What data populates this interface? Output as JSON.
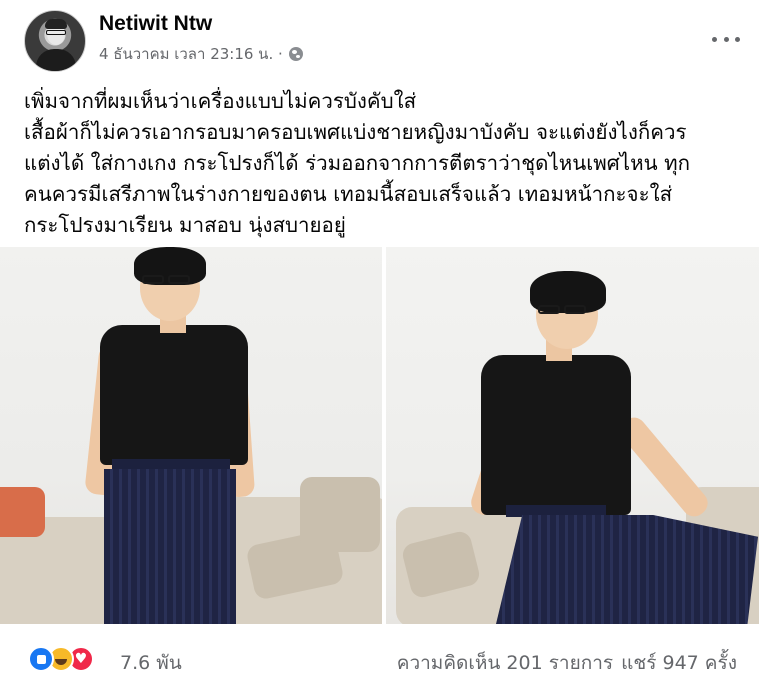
{
  "post": {
    "author": "Netiwit Ntw",
    "timestamp": "4 ธันวาคม เวลา 23:16 น. ·",
    "privacy_icon": "globe-icon",
    "text_lines": [
      "เพิ่มจากที่ผมเห็นว่าเครื่องแบบไม่ควรบังคับใส่",
      "เสื้อผ้าก็ไม่ควรเอากรอบมาครอบเพศแบ่งชายหญิงมาบังคับ จะแต่งยังไงก็ควร",
      "แต่งได้ ใส่กางเกง กระโปรงก็ได้ ร่วมออกจากการตีตราว่าชุดไหนเพศไหน ทุก",
      "คนควรมีเสรีภาพในร่างกายของตน เทอมนี้สอบเสร็จแล้ว เทอมหน้ากะจะใส่",
      "กระโปรงมาเรียน มาสอบ นุ่งสบายอยู่"
    ]
  },
  "footer": {
    "reaction_icons": [
      "like-icon",
      "haha-icon",
      "love-icon"
    ],
    "reaction_count": "7.6 พัน",
    "comments": "ความคิดเห็น 201 รายการ",
    "shares": "แชร์ 947 ครั้ง"
  },
  "colors": {
    "text": "#050505",
    "secondary": "#65676b",
    "like": "#1877f2",
    "haha": "#f7b928",
    "love": "#f02849"
  }
}
